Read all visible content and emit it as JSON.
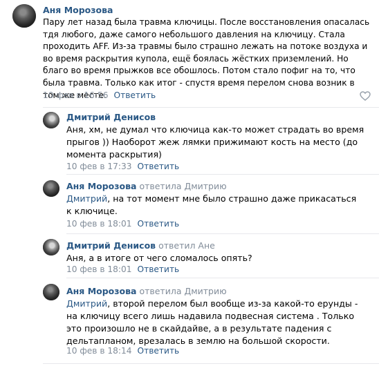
{
  "comments": [
    {
      "author": "Аня Морозова",
      "reply_to": "",
      "mention": "",
      "text": "Пару лет назад была травма ключицы. После восстановления опасалась тдя любого, даже самого небольшого давления на ключицу. Стала проходить AFF. Из-за травмы было страшно лежать на потоке воздуха и во время раскрытия купола, ещё боялась жёстких приземлений. Но благо во время прыжков все обошлось. Потом стало пофиг на то, что была травма. Только как итог - спустя время перелом снова возник в том же месте.",
      "date": "10 фев в 16:56",
      "reply_label": "Ответить"
    },
    {
      "author": "Дмитрий Денисов",
      "reply_to": "",
      "mention": "",
      "text": "Аня, хм, не думал что ключица как-то может страдать во время прыгов )) Наоборот жеж лямки прижимают кость на место (до момента раскрытия)",
      "date": "10 фев в 17:33",
      "reply_label": "Ответить"
    },
    {
      "author": "Аня Морозова",
      "reply_to": "ответила Дмитрию",
      "mention": "Дмитрий",
      "text": ", на тот момент мне было страшно даже прикасаться к ключице.",
      "date": "10 фев в 18:01",
      "reply_label": "Ответить"
    },
    {
      "author": "Дмитрий Денисов",
      "reply_to": "ответил Ане",
      "mention": "",
      "text": "Аня, а в итоге от чего сломалось опять?",
      "date": "10 фев в 18:01",
      "reply_label": "Ответить"
    },
    {
      "author": "Аня Морозова",
      "reply_to": "ответила Дмитрию",
      "mention": "Дмитрий",
      "text": ", второй перелом был вообще из-за какой-то ерунды - на ключицу всего лишь надавила подвесная система . Только это произошло не в скайдайве, а в результате падения с дельтапланом, врезалась в землю на большой скорости.",
      "date": "10 фев в 18:14",
      "reply_label": "Ответить"
    }
  ],
  "icons": {
    "like": "heart-icon",
    "avatar": "user-avatar"
  },
  "colors": {
    "author": "#2a5885",
    "meta": "#818c99",
    "separator": "#e7e8ec"
  }
}
